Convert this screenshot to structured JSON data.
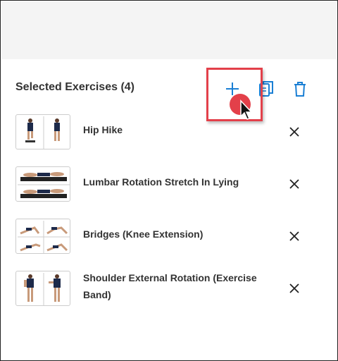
{
  "panel": {
    "title": "Selected Exercises (4)"
  },
  "colors": {
    "accent": "#1a7fd4",
    "highlight": "#e3404a",
    "text": "#333333"
  },
  "toolbar": {
    "add_icon": "plus-icon",
    "copy_icon": "copy-icon",
    "delete_icon": "trash-icon"
  },
  "exercises": [
    {
      "name": "Hip Hike",
      "remove_icon": "close-icon"
    },
    {
      "name": "Lumbar Rotation Stretch In Lying",
      "remove_icon": "close-icon"
    },
    {
      "name": "Bridges (Knee Extension)",
      "remove_icon": "close-icon"
    },
    {
      "name": "Shoulder External Rotation (Exercise Band)",
      "remove_icon": "close-icon"
    }
  ]
}
